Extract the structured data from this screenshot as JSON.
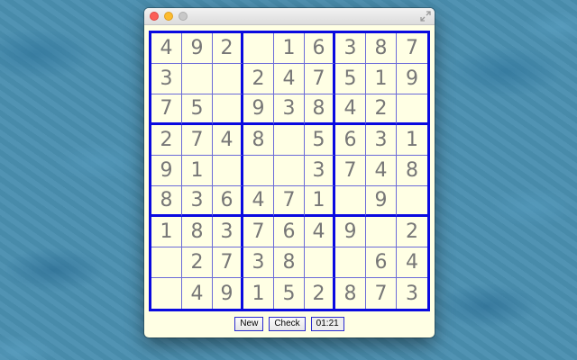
{
  "window": {
    "buttons": [
      "close",
      "minimize",
      "zoom"
    ],
    "fullscreen_icon": "fullscreen-arrows-icon"
  },
  "board": {
    "rows": [
      [
        "4",
        "9",
        "2",
        "",
        "1",
        "6",
        "3",
        "8",
        "7"
      ],
      [
        "3",
        "",
        "",
        "2",
        "4",
        "7",
        "5",
        "1",
        "9"
      ],
      [
        "7",
        "5",
        "",
        "9",
        "3",
        "8",
        "4",
        "2",
        ""
      ],
      [
        "2",
        "7",
        "4",
        "8",
        "",
        "5",
        "6",
        "3",
        "1"
      ],
      [
        "9",
        "1",
        "",
        "",
        "",
        "3",
        "7",
        "4",
        "8"
      ],
      [
        "8",
        "3",
        "6",
        "4",
        "7",
        "1",
        "",
        "9",
        ""
      ],
      [
        "1",
        "8",
        "3",
        "7",
        "6",
        "4",
        "9",
        "",
        "2"
      ],
      [
        "",
        "2",
        "7",
        "3",
        "8",
        "",
        "",
        "6",
        "4"
      ],
      [
        "",
        "4",
        "9",
        "1",
        "5",
        "2",
        "8",
        "7",
        "3"
      ]
    ],
    "colors": {
      "thick_line": "#0a0ae0",
      "thin_line": "#6b6bd8",
      "cell_background": "#ffffe4",
      "digit": "#777777"
    }
  },
  "controls": {
    "new_label": "New",
    "check_label": "Check",
    "timer": "01:21"
  }
}
